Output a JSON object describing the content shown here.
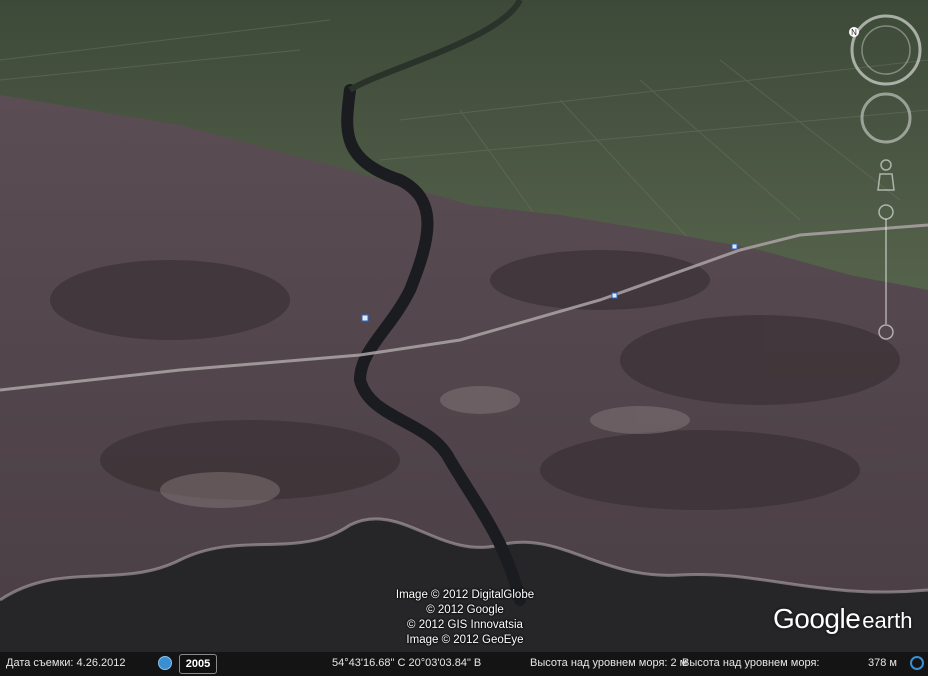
{
  "map": {
    "view": "aerial-3d-tilted",
    "colors": {
      "sea": "#262628",
      "heath": "#5c4f55",
      "fields": "#4d5a45",
      "river": "#1a1c20"
    }
  },
  "credits": {
    "line1": "Image © 2012 DigitalGlobe",
    "line2": "© 2012 Google",
    "line3": "© 2012 GIS Innovatsia",
    "line4": "Image © 2012 GeoEye"
  },
  "logo": {
    "google": "Google",
    "earth": "earth"
  },
  "status": {
    "imagery_date_label": "Дата съемки: 4.26.2012",
    "year": "2005",
    "coords": "54°43'16.68\" С  20°03'03.84\" В",
    "elevation_text": "Высота над уровнем моря:   2 м",
    "eye_alt_label": "Высота над уровнем моря:",
    "eye_alt_value": "378 м"
  },
  "icons": {
    "history": "historical-imagery-icon",
    "stream": "streaming-status-icon",
    "nav": [
      "north-icon",
      "look-ring-icon",
      "move-ring-icon",
      "street-view-pegman-icon",
      "zoom-slider-icon"
    ]
  }
}
